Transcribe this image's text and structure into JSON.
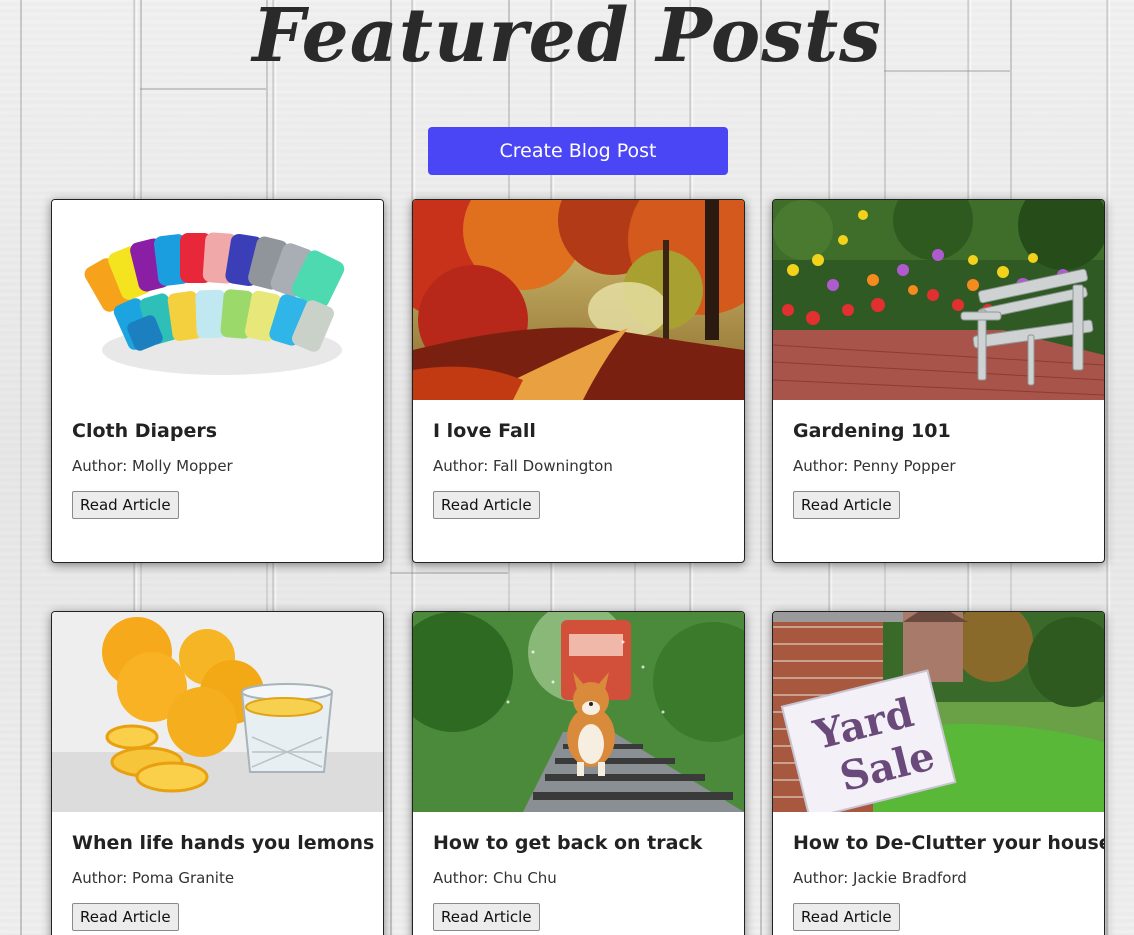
{
  "page": {
    "title": "Featured Posts",
    "create_button_label": "Create Blog Post"
  },
  "colors": {
    "accent": "#4a45f5",
    "title_text": "#2a2a2a",
    "card_bg": "#ffffff"
  },
  "posts": [
    {
      "title": "Cloth Diapers",
      "author": "Author: Molly Mopper",
      "button_label": "Read Article",
      "image": "colorful-cloth-diapers"
    },
    {
      "title": "I love Fall",
      "author": "Author: Fall Downington",
      "button_label": "Read Article",
      "image": "autumn-forest-path"
    },
    {
      "title": "Gardening 101",
      "author": "Author: Penny Popper",
      "button_label": "Read Article",
      "image": "flower-garden-bench"
    },
    {
      "title": "When life hands you lemons",
      "author": "Author: Poma Granite",
      "button_label": "Read Article",
      "image": "lemons-and-water-glass"
    },
    {
      "title": "How to get back on track",
      "author": "Author: Chu Chu",
      "button_label": "Read Article",
      "image": "corgi-on-railroad-track"
    },
    {
      "title": "How to De-Clutter your house!",
      "author": "Author: Jackie Bradford",
      "button_label": "Read Article",
      "image": "yard-sale-sign"
    }
  ],
  "yard_sign_text": [
    "Yard",
    "Sale"
  ]
}
